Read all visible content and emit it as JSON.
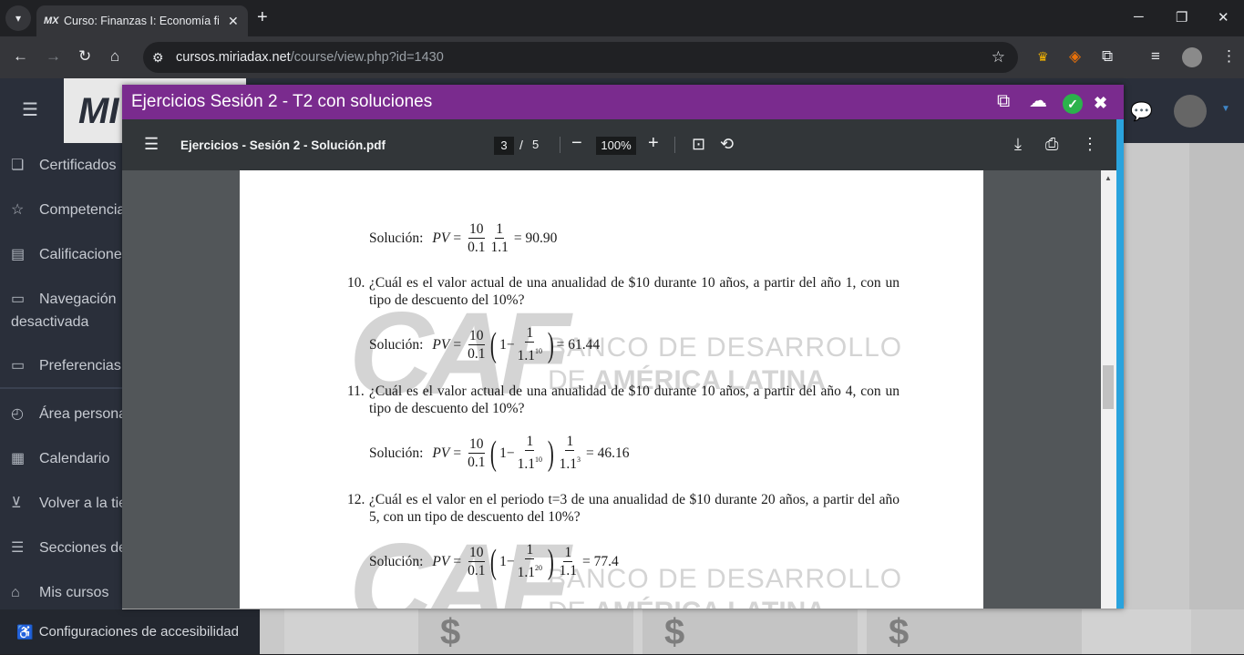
{
  "browser": {
    "tab_title": "Curso: Finanzas I: Economía fina",
    "favicon_text": "MX",
    "url_host": "cursos.miriadax.net",
    "url_path": "/course/view.php?id=1430"
  },
  "site": {
    "logo_text": "MI",
    "sidebar": [
      {
        "icon": "certificate-icon",
        "label": "Certificados"
      },
      {
        "icon": "star-icon",
        "label": "Competencias"
      },
      {
        "icon": "grades-icon",
        "label": "Calificaciones"
      },
      {
        "icon": "folder-icon",
        "label": "Navegación desactivada"
      },
      {
        "icon": "folder-icon",
        "label": "Preferencias"
      },
      {
        "icon": "dashboard-icon",
        "label": "Área personal"
      },
      {
        "icon": "calendar-icon",
        "label": "Calendario"
      },
      {
        "icon": "cart-icon",
        "label": "Volver a la tienda"
      },
      {
        "icon": "list-icon",
        "label": "Secciones del curso"
      },
      {
        "icon": "graduation-icon",
        "label": "Mis cursos"
      }
    ],
    "accessibility_label": "Configuraciones de accesibilidad",
    "card_symbol": "$"
  },
  "modal": {
    "title": "Ejercicios Sesión 2 - T2 con soluciones",
    "header_color": "#7a2b8e"
  },
  "pdf": {
    "filename": "Ejercicios - Sesión 2 - Solución.pdf",
    "current_page": "3",
    "page_separator": "/",
    "total_pages": "5",
    "zoom": "100%"
  },
  "document": {
    "watermark": {
      "logo": "CAF",
      "line1": "BANCO DE DESARROLLO",
      "line2_prefix": "DE ",
      "line2_bold": "AMÉRICA LATINA"
    },
    "solution_label": "Solución:",
    "sol9": {
      "lhs": "PV",
      "n1": "10",
      "d1": "0.1",
      "n2": "1",
      "d2": "1.1",
      "result": "= 90.90"
    },
    "q10": {
      "num": "10.",
      "text": "¿Cuál es el valor actual de una anualidad de $10 durante 10 años, a partir del año 1, con un tipo de descuento del 10%?"
    },
    "sol10": {
      "lhs": "PV",
      "n1": "10",
      "d1": "0.1",
      "inner_one": "1−",
      "n2": "1",
      "d2_base": "1.1",
      "d2_exp": "10",
      "result": "= 61.44"
    },
    "q11": {
      "num": "11.",
      "text": "¿Cuál es el valor actual de una anualidad de $10 durante 10 años, a partir del año 4, con un tipo de descuento del 10%?"
    },
    "sol11": {
      "lhs": "PV",
      "n1": "10",
      "d1": "0.1",
      "inner_one": "1−",
      "n2": "1",
      "d2_base": "1.1",
      "d2_exp": "10",
      "n3": "1",
      "d3_base": "1.1",
      "d3_exp": "3",
      "result": "= 46.16"
    },
    "q12": {
      "num": "12.",
      "text": "¿Cuál es el valor en el periodo t=3 de una anualidad de $10 durante 20 años, a partir del año 5, con un tipo de descuento del 10%?"
    },
    "sol12": {
      "lhs": "PV",
      "n1": "10",
      "d1": "0.1",
      "inner_one": "1−",
      "n2": "1",
      "d2_base": "1.1",
      "d2_exp": "20",
      "n3": "1",
      "d3": "1.1",
      "result": "= 77.4"
    }
  }
}
